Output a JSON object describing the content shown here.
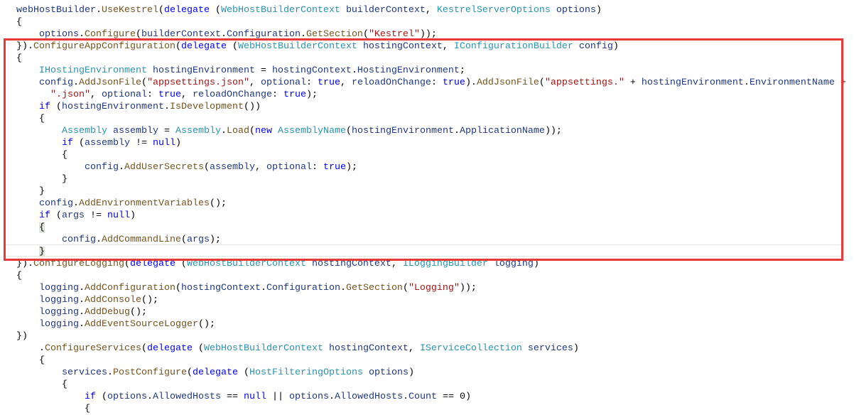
{
  "editor": {
    "highlight_color": "#e8393a",
    "lines": [
      {
        "indent": 0,
        "tokens": [
          [
            "i",
            "webHostBuilder"
          ],
          [
            "p",
            "."
          ],
          [
            "m",
            "UseKestrel"
          ],
          [
            "p",
            "("
          ],
          [
            "k",
            "delegate"
          ],
          [
            "p",
            " ("
          ],
          [
            "t",
            "WebHostBuilderContext"
          ],
          [
            "p",
            " "
          ],
          [
            "i",
            "builderContext"
          ],
          [
            "p",
            ", "
          ],
          [
            "t",
            "KestrelServerOptions"
          ],
          [
            "p",
            " "
          ],
          [
            "i",
            "options"
          ],
          [
            "p",
            ")"
          ]
        ]
      },
      {
        "indent": 0,
        "tokens": [
          [
            "p",
            "{"
          ]
        ]
      },
      {
        "indent": 4,
        "tokens": [
          [
            "i",
            "options"
          ],
          [
            "p",
            "."
          ],
          [
            "m",
            "Configure"
          ],
          [
            "p",
            "("
          ],
          [
            "i",
            "builderContext"
          ],
          [
            "p",
            "."
          ],
          [
            "i",
            "Configuration"
          ],
          [
            "p",
            "."
          ],
          [
            "m",
            "GetSection"
          ],
          [
            "p",
            "("
          ],
          [
            "s",
            "\"Kestrel\""
          ],
          [
            "p",
            "));"
          ]
        ]
      },
      {
        "indent": 0,
        "tokens": [
          [
            "p",
            "})."
          ],
          [
            "m",
            "ConfigureAppConfiguration"
          ],
          [
            "p",
            "("
          ],
          [
            "k",
            "delegate"
          ],
          [
            "p",
            " ("
          ],
          [
            "t",
            "WebHostBuilderContext"
          ],
          [
            "p",
            " "
          ],
          [
            "i",
            "hostingContext"
          ],
          [
            "p",
            ", "
          ],
          [
            "t",
            "IConfigurationBuilder"
          ],
          [
            "p",
            " "
          ],
          [
            "i",
            "config"
          ],
          [
            "p",
            ")"
          ]
        ]
      },
      {
        "indent": 0,
        "tokens": [
          [
            "p",
            "{"
          ]
        ]
      },
      {
        "indent": 4,
        "tokens": [
          [
            "t",
            "IHostingEnvironment"
          ],
          [
            "p",
            " "
          ],
          [
            "i",
            "hostingEnvironment"
          ],
          [
            "p",
            " = "
          ],
          [
            "i",
            "hostingContext"
          ],
          [
            "p",
            "."
          ],
          [
            "i",
            "HostingEnvironment"
          ],
          [
            "p",
            ";"
          ]
        ]
      },
      {
        "indent": 4,
        "tokens": [
          [
            "i",
            "config"
          ],
          [
            "p",
            "."
          ],
          [
            "m",
            "AddJsonFile"
          ],
          [
            "p",
            "("
          ],
          [
            "s",
            "\"appsettings.json\""
          ],
          [
            "p",
            ", "
          ],
          [
            "i",
            "optional"
          ],
          [
            "p",
            ": "
          ],
          [
            "k",
            "true"
          ],
          [
            "p",
            ", "
          ],
          [
            "i",
            "reloadOnChange"
          ],
          [
            "p",
            ": "
          ],
          [
            "k",
            "true"
          ],
          [
            "p",
            ")."
          ],
          [
            "m",
            "AddJsonFile"
          ],
          [
            "p",
            "("
          ],
          [
            "s",
            "\"appsettings.\""
          ],
          [
            "p",
            " + "
          ],
          [
            "i",
            "hostingEnvironment"
          ],
          [
            "p",
            "."
          ],
          [
            "i",
            "EnvironmentName"
          ],
          [
            "p",
            " +"
          ]
        ]
      },
      {
        "indent": 6,
        "tokens": [
          [
            "s",
            "\".json\""
          ],
          [
            "p",
            ", "
          ],
          [
            "i",
            "optional"
          ],
          [
            "p",
            ": "
          ],
          [
            "k",
            "true"
          ],
          [
            "p",
            ", "
          ],
          [
            "i",
            "reloadOnChange"
          ],
          [
            "p",
            ": "
          ],
          [
            "k",
            "true"
          ],
          [
            "p",
            ");"
          ]
        ]
      },
      {
        "indent": 4,
        "tokens": [
          [
            "k",
            "if"
          ],
          [
            "p",
            " ("
          ],
          [
            "i",
            "hostingEnvironment"
          ],
          [
            "p",
            "."
          ],
          [
            "m",
            "IsDevelopment"
          ],
          [
            "p",
            "())"
          ]
        ]
      },
      {
        "indent": 4,
        "tokens": [
          [
            "p",
            "{"
          ]
        ]
      },
      {
        "indent": 8,
        "tokens": [
          [
            "t",
            "Assembly"
          ],
          [
            "p",
            " "
          ],
          [
            "i",
            "assembly"
          ],
          [
            "p",
            " = "
          ],
          [
            "t",
            "Assembly"
          ],
          [
            "p",
            "."
          ],
          [
            "m",
            "Load"
          ],
          [
            "p",
            "("
          ],
          [
            "k",
            "new"
          ],
          [
            "p",
            " "
          ],
          [
            "t",
            "AssemblyName"
          ],
          [
            "p",
            "("
          ],
          [
            "i",
            "hostingEnvironment"
          ],
          [
            "p",
            "."
          ],
          [
            "i",
            "ApplicationName"
          ],
          [
            "p",
            "));"
          ]
        ]
      },
      {
        "indent": 8,
        "tokens": [
          [
            "k",
            "if"
          ],
          [
            "p",
            " ("
          ],
          [
            "i",
            "assembly"
          ],
          [
            "p",
            " != "
          ],
          [
            "k",
            "null"
          ],
          [
            "p",
            ")"
          ]
        ]
      },
      {
        "indent": 8,
        "tokens": [
          [
            "p",
            "{"
          ]
        ]
      },
      {
        "indent": 12,
        "tokens": [
          [
            "i",
            "config"
          ],
          [
            "p",
            "."
          ],
          [
            "m",
            "AddUserSecrets"
          ],
          [
            "p",
            "("
          ],
          [
            "i",
            "assembly"
          ],
          [
            "p",
            ", "
          ],
          [
            "i",
            "optional"
          ],
          [
            "p",
            ": "
          ],
          [
            "k",
            "true"
          ],
          [
            "p",
            ");"
          ]
        ]
      },
      {
        "indent": 8,
        "tokens": [
          [
            "p",
            "}"
          ]
        ]
      },
      {
        "indent": 4,
        "tokens": [
          [
            "p",
            "}"
          ]
        ]
      },
      {
        "indent": 4,
        "tokens": [
          [
            "i",
            "config"
          ],
          [
            "p",
            "."
          ],
          [
            "m",
            "AddEnvironmentVariables"
          ],
          [
            "p",
            "();"
          ]
        ]
      },
      {
        "indent": 4,
        "tokens": [
          [
            "k",
            "if"
          ],
          [
            "p",
            " ("
          ],
          [
            "i",
            "args"
          ],
          [
            "p",
            " != "
          ],
          [
            "k",
            "null"
          ],
          [
            "p",
            ")"
          ]
        ]
      },
      {
        "indent": 4,
        "tokens": [
          [
            "p brace",
            "{"
          ]
        ]
      },
      {
        "indent": 8,
        "tokens": [
          [
            "i",
            "config"
          ],
          [
            "p",
            "."
          ],
          [
            "m",
            "AddCommandLine"
          ],
          [
            "p",
            "("
          ],
          [
            "i",
            "args"
          ],
          [
            "p",
            ");"
          ]
        ]
      },
      {
        "indent": 4,
        "tokens": [
          [
            "p brace",
            "}"
          ]
        ]
      },
      {
        "indent": 0,
        "tokens": [
          [
            "p",
            "})."
          ],
          [
            "m",
            "ConfigureLogging"
          ],
          [
            "p",
            "("
          ],
          [
            "k",
            "delegate"
          ],
          [
            "p",
            " ("
          ],
          [
            "t",
            "WebHostBuilderContext"
          ],
          [
            "p",
            " "
          ],
          [
            "i",
            "hostingContext"
          ],
          [
            "p",
            ", "
          ],
          [
            "t",
            "ILoggingBuilder"
          ],
          [
            "p",
            " "
          ],
          [
            "i",
            "logging"
          ],
          [
            "p",
            ")"
          ]
        ]
      },
      {
        "indent": 0,
        "tokens": [
          [
            "p",
            "{"
          ]
        ]
      },
      {
        "indent": 4,
        "tokens": [
          [
            "i",
            "logging"
          ],
          [
            "p",
            "."
          ],
          [
            "m",
            "AddConfiguration"
          ],
          [
            "p",
            "("
          ],
          [
            "i",
            "hostingContext"
          ],
          [
            "p",
            "."
          ],
          [
            "i",
            "Configuration"
          ],
          [
            "p",
            "."
          ],
          [
            "m",
            "GetSection"
          ],
          [
            "p",
            "("
          ],
          [
            "s",
            "\"Logging\""
          ],
          [
            "p",
            "));"
          ]
        ]
      },
      {
        "indent": 4,
        "tokens": [
          [
            "i",
            "logging"
          ],
          [
            "p",
            "."
          ],
          [
            "m",
            "AddConsole"
          ],
          [
            "p",
            "();"
          ]
        ]
      },
      {
        "indent": 4,
        "tokens": [
          [
            "i",
            "logging"
          ],
          [
            "p",
            "."
          ],
          [
            "m",
            "AddDebug"
          ],
          [
            "p",
            "();"
          ]
        ]
      },
      {
        "indent": 4,
        "tokens": [
          [
            "i",
            "logging"
          ],
          [
            "p",
            "."
          ],
          [
            "m",
            "AddEventSourceLogger"
          ],
          [
            "p",
            "();"
          ]
        ]
      },
      {
        "indent": 0,
        "tokens": [
          [
            "p",
            "})"
          ]
        ]
      },
      {
        "indent": 4,
        "tokens": [
          [
            "p",
            "."
          ],
          [
            "m",
            "ConfigureServices"
          ],
          [
            "p",
            "("
          ],
          [
            "k",
            "delegate"
          ],
          [
            "p",
            " ("
          ],
          [
            "t",
            "WebHostBuilderContext"
          ],
          [
            "p",
            " "
          ],
          [
            "i",
            "hostingContext"
          ],
          [
            "p",
            ", "
          ],
          [
            "t",
            "IServiceCollection"
          ],
          [
            "p",
            " "
          ],
          [
            "i",
            "services"
          ],
          [
            "p",
            ")"
          ]
        ]
      },
      {
        "indent": 4,
        "tokens": [
          [
            "p",
            "{"
          ]
        ]
      },
      {
        "indent": 8,
        "tokens": [
          [
            "i",
            "services"
          ],
          [
            "p",
            "."
          ],
          [
            "m",
            "PostConfigure"
          ],
          [
            "p",
            "("
          ],
          [
            "k",
            "delegate"
          ],
          [
            "p",
            " ("
          ],
          [
            "t",
            "HostFilteringOptions"
          ],
          [
            "p",
            " "
          ],
          [
            "i",
            "options"
          ],
          [
            "p",
            ")"
          ]
        ]
      },
      {
        "indent": 8,
        "tokens": [
          [
            "p",
            "{"
          ]
        ]
      },
      {
        "indent": 12,
        "tokens": [
          [
            "k",
            "if"
          ],
          [
            "p",
            " ("
          ],
          [
            "i",
            "options"
          ],
          [
            "p",
            "."
          ],
          [
            "i",
            "AllowedHosts"
          ],
          [
            "p",
            " == "
          ],
          [
            "k",
            "null"
          ],
          [
            "p",
            " || "
          ],
          [
            "i",
            "options"
          ],
          [
            "p",
            "."
          ],
          [
            "i",
            "AllowedHosts"
          ],
          [
            "p",
            "."
          ],
          [
            "i",
            "Count"
          ],
          [
            "p",
            " == 0)"
          ]
        ]
      },
      {
        "indent": 12,
        "tokens": [
          [
            "p",
            "{"
          ]
        ]
      }
    ]
  }
}
